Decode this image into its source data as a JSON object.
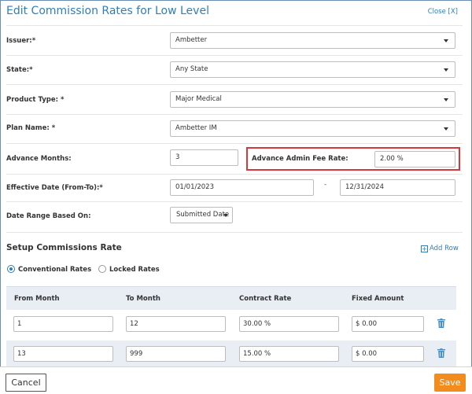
{
  "header": {
    "title": "Edit Commission Rates for Low Level",
    "close_label": "Close [X]"
  },
  "form": {
    "issuer": {
      "label": "Issuer:*",
      "value": "Ambetter"
    },
    "state": {
      "label": "State:*",
      "value": "Any State"
    },
    "product_type": {
      "label": "Product Type: *",
      "value": "Major Medical"
    },
    "plan_name": {
      "label": "Plan Name: *",
      "value": "Ambetter IM"
    },
    "advance_months": {
      "label": "Advance Months:",
      "value": "3"
    },
    "advance_admin_fee": {
      "label": "Advance Admin Fee Rate:",
      "value": "2.00 %"
    },
    "effective_date": {
      "label": "Effective Date (From-To):*",
      "from": "01/01/2023",
      "separator": "-",
      "to": "12/31/2024"
    },
    "date_range": {
      "label": "Date Range Based On:",
      "value": "Submitted Date"
    }
  },
  "commissions": {
    "title": "Setup Commissions Rate",
    "add_row_label": "Add Row",
    "rate_options": [
      {
        "label": "Conventional Rates",
        "checked": true
      },
      {
        "label": "Locked Rates",
        "checked": false
      }
    ],
    "columns": [
      "From Month",
      "To Month",
      "Contract Rate",
      "Fixed Amount"
    ],
    "rows": [
      {
        "from": "1",
        "to": "12",
        "rate": "30.00 %",
        "fixed": "$ 0.00"
      },
      {
        "from": "13",
        "to": "999",
        "rate": "15.00 %",
        "fixed": "$ 0.00"
      }
    ]
  },
  "footer": {
    "cancel_label": "Cancel",
    "save_label": "Save"
  },
  "colors": {
    "title_blue": "#2f7fb6",
    "highlight_red": "#d9363e",
    "save_orange": "#f28c1c",
    "table_header_bg": "#e8eef4"
  }
}
